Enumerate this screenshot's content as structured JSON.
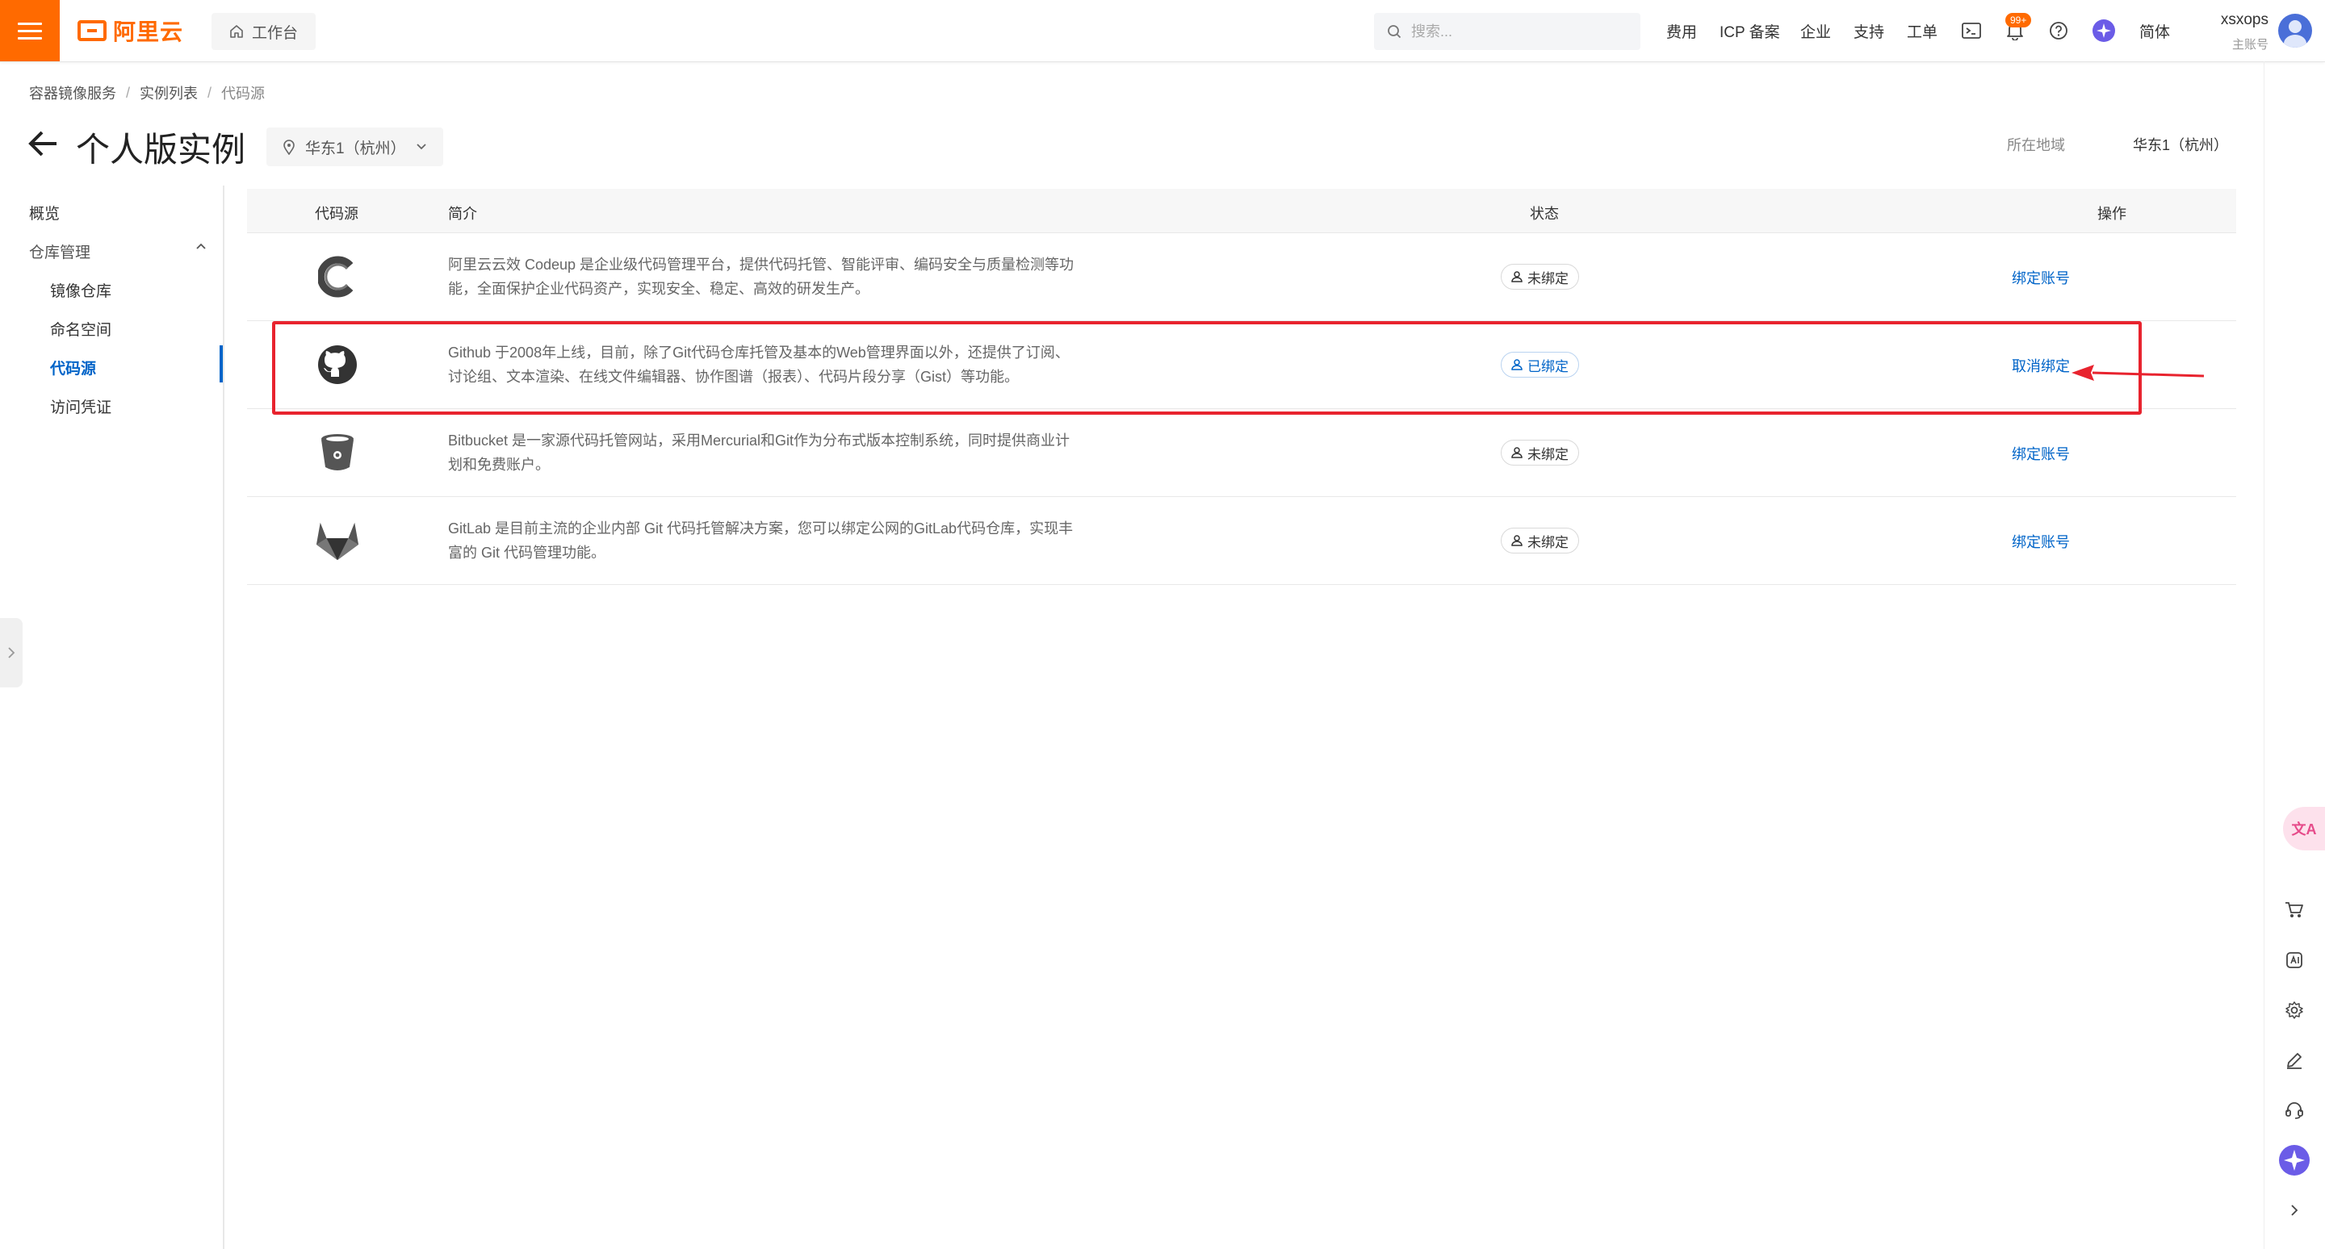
{
  "topbar": {
    "logo_text": "阿里云",
    "workbench_label": "工作台",
    "search_placeholder": "搜索...",
    "nav": [
      "费用",
      "ICP 备案",
      "企业",
      "支持",
      "工单"
    ],
    "notification_badge": "99+",
    "language_label": "简体",
    "user_name": "xsxops",
    "user_role": "主账号",
    "accent_color": "#ff6a00"
  },
  "breadcrumb": [
    "容器镜像服务",
    "实例列表",
    "代码源"
  ],
  "page": {
    "title": "个人版实例",
    "region_select": "华东1（杭州）",
    "region_label": "所在地域",
    "region_value": "华东1（杭州）"
  },
  "sidebar": {
    "overview": "概览",
    "repo_management": "仓库管理",
    "items": [
      "镜像仓库",
      "命名空间",
      "代码源"
    ],
    "credentials": "访问凭证",
    "active_item": "代码源"
  },
  "table": {
    "headers": [
      "代码源",
      "简介",
      "状态",
      "操作"
    ],
    "rows": [
      {
        "source": "Codeup",
        "icon": "codeup-icon",
        "description": "阿里云云效 Codeup 是企业级代码管理平台，提供代码托管、智能评审、编码安全与质量检测等功能，全面保护企业代码资产，实现安全、稳定、高效的研发生产。",
        "status": "未绑定",
        "action": "绑定账号"
      },
      {
        "source": "GitHub",
        "icon": "github-icon",
        "description": "Github 于2008年上线，目前，除了Git代码仓库托管及基本的Web管理界面以外，还提供了订阅、讨论组、文本渲染、在线文件编辑器、协作图谱（报表）、代码片段分享（Gist）等功能。",
        "status": "已绑定",
        "action": "取消绑定"
      },
      {
        "source": "Bitbucket",
        "icon": "bitbucket-icon",
        "description": "Bitbucket 是一家源代码托管网站，采用Mercurial和Git作为分布式版本控制系统，同时提供商业计划和免费账户。",
        "status": "未绑定",
        "action": "绑定账号"
      },
      {
        "source": "GitLab",
        "icon": "gitlab-icon",
        "description": "GitLab 是目前主流的企业内部 Git 代码托管解决方案，您可以绑定公网的GitLab代码仓库，实现丰富的 Git 代码管理功能。",
        "status": "未绑定",
        "action": "绑定账号"
      }
    ]
  },
  "right_rail": {
    "translate_label": "文A",
    "icons": [
      "cart-icon",
      "ai-assistant-icon",
      "settings-icon",
      "edit-icon",
      "headset-icon",
      "sparkle-icon",
      "chevron-right-icon"
    ]
  },
  "colors": {
    "link": "#0064c8",
    "highlight": "#e8232e"
  }
}
